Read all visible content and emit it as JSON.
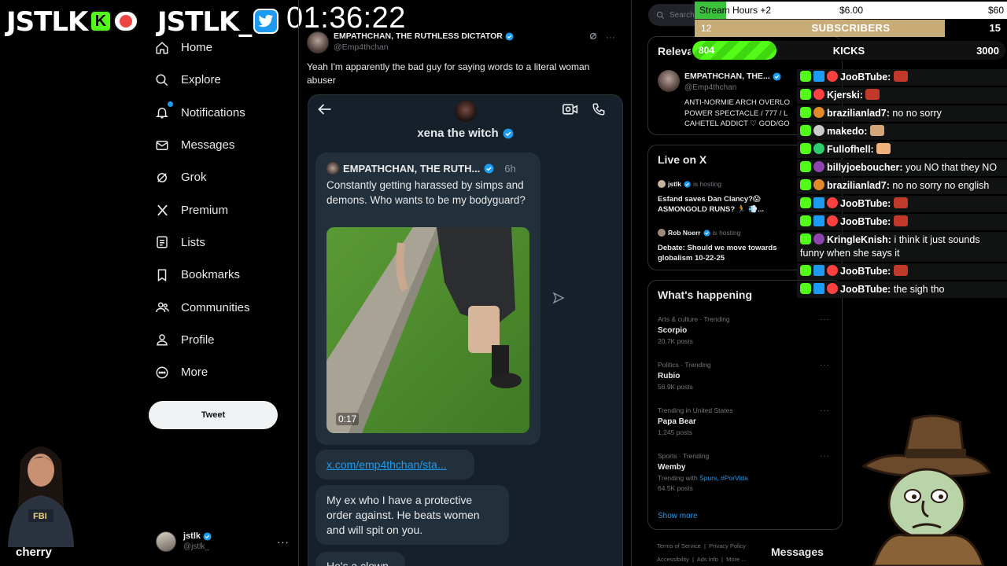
{
  "overlay": {
    "logo_left": "JSTLK",
    "logo_right": "JSTLK_",
    "timer": "01:36:22",
    "stream_hours": {
      "label": "Stream Hours +2",
      "current": "$6.00",
      "goal": "$60",
      "progress": 0.1
    },
    "subscribers": {
      "current": "12",
      "label": "SUBSCRIBERS",
      "goal": "15",
      "progress": 0.8
    },
    "kicks": {
      "current": "804",
      "label": "KICKS",
      "goal": "3000",
      "progress": 0.268
    },
    "bottom_left_label": "cherry",
    "messages_label": "Messages"
  },
  "sidebar": {
    "items": [
      {
        "label": "Home",
        "icon": "home-icon"
      },
      {
        "label": "Explore",
        "icon": "search-icon"
      },
      {
        "label": "Notifications",
        "icon": "bell-icon"
      },
      {
        "label": "Messages",
        "icon": "envelope-icon"
      },
      {
        "label": "Grok",
        "icon": "grok-icon"
      },
      {
        "label": "Premium",
        "icon": "x-logo-icon"
      },
      {
        "label": "Lists",
        "icon": "list-icon"
      },
      {
        "label": "Bookmarks",
        "icon": "bookmark-icon"
      },
      {
        "label": "Communities",
        "icon": "people-icon"
      },
      {
        "label": "Profile",
        "icon": "person-icon"
      },
      {
        "label": "More",
        "icon": "more-circle-icon"
      }
    ],
    "tweet_button": "Tweet",
    "account": {
      "name": "jstlk",
      "handle": "@jstlk_"
    }
  },
  "tweet": {
    "author_name": "EMPATHCHAN, THE RUTHLESS DICTATOR",
    "author_handle": "@Emp4thchan",
    "text": "Yeah I'm apparently the bad guy for saying words to a literal woman abuser",
    "dm": {
      "title": "xena the witch",
      "quote_author": "EMPATHCHAN, THE RUTH...",
      "quote_time": "6h",
      "quote_text": "Constantly getting harassed by simps and demons. Who wants to be my bodyguard?",
      "video_duration": "0:17",
      "link": "x.com/emp4thchan/sta...",
      "reply1": "My ex who I have a protective order against. He beats women and will spit on you.",
      "reply2": "He's a clown"
    }
  },
  "right": {
    "search_placeholder": "Search",
    "relevant": {
      "title": "Relevant people",
      "name": "EMPATHCHAN, THE...",
      "handle": "@Emp4thchan",
      "bio": "ANTI-NORMIE ARCH OVERLO\nPOWER SPECTACLE / 777 / L\nCAHETEL ADDICT ♡ GOD/GO"
    },
    "live": {
      "title": "Live on X",
      "items": [
        {
          "host": "jstlk",
          "hosting": "is hosting",
          "title": "Esfand saves Dan Clancy?😱 ASMONGOLD RUNS? 🏃 💨..."
        },
        {
          "host": "Rob Noerr",
          "hosting": "is hosting",
          "title": "Debate: Should we move towards globalism 10-22-25"
        }
      ]
    },
    "happening": {
      "title": "What's happening",
      "trends": [
        {
          "category": "Arts & culture · Trending",
          "name": "Scorpio",
          "sub": "20.7K posts"
        },
        {
          "category": "Politics · Trending",
          "name": "Rubio",
          "sub": "56.9K posts"
        },
        {
          "category": "Trending in United States",
          "name": "Papa Bear",
          "sub": "1,245 posts"
        },
        {
          "category": "Sports · Trending",
          "name": "Wemby",
          "sub_prefix": "Trending with",
          "sub_links": "Spurs, #PorVida",
          "sub": "64.5K posts"
        }
      ],
      "show_more": "Show more"
    },
    "footer": {
      "line1": [
        "Terms of Service",
        "Privacy Policy"
      ],
      "line2": [
        "Accessibility",
        "Ads info",
        "More ..."
      ]
    }
  },
  "chat": [
    {
      "user": "JooBTube:",
      "text": "",
      "color": "#ff4040",
      "badges": [
        "mod",
        "tier"
      ],
      "emote": "#c0392b"
    },
    {
      "user": "Kjerski:",
      "text": "",
      "color": "#ff4040",
      "badges": [
        "mod"
      ],
      "emote": "#c0392b"
    },
    {
      "user": "brazilianlad7:",
      "text": "no no sorry",
      "color": "#e08a2a",
      "badges": [
        "mod"
      ]
    },
    {
      "user": "makedo:",
      "text": "",
      "color": "#cccccc",
      "badges": [
        "mod"
      ],
      "emote": "#d2a679"
    },
    {
      "user": "Fullofhell:",
      "text": "",
      "color": "#2ecc71",
      "badges": [
        "mod"
      ],
      "emote": "#f0b27a"
    },
    {
      "user": "billyjoeboucher:",
      "text": "you NO that they NO",
      "color": "#8e44ad",
      "badges": [
        "mod"
      ]
    },
    {
      "user": "brazilianlad7:",
      "text": "no no sorry no english",
      "color": "#e08a2a",
      "badges": [
        "mod"
      ]
    },
    {
      "user": "JooBTube:",
      "text": "",
      "color": "#ff4040",
      "badges": [
        "mod",
        "tier"
      ],
      "emote": "#c0392b"
    },
    {
      "user": "JooBTube:",
      "text": "",
      "color": "#ff4040",
      "badges": [
        "mod",
        "tier"
      ],
      "emote": "#c0392b"
    },
    {
      "user": "KringleKnish:",
      "text": "i think it just sounds funny when she says it",
      "color": "#8e44ad",
      "badges": [
        "mod"
      ]
    },
    {
      "user": "JooBTube:",
      "text": "",
      "color": "#ff4040",
      "badges": [
        "mod",
        "tier"
      ],
      "emote": "#c0392b"
    },
    {
      "user": "JooBTube:",
      "text": "the sigh tho",
      "color": "#ff4040",
      "badges": [
        "mod",
        "tier"
      ]
    }
  ]
}
